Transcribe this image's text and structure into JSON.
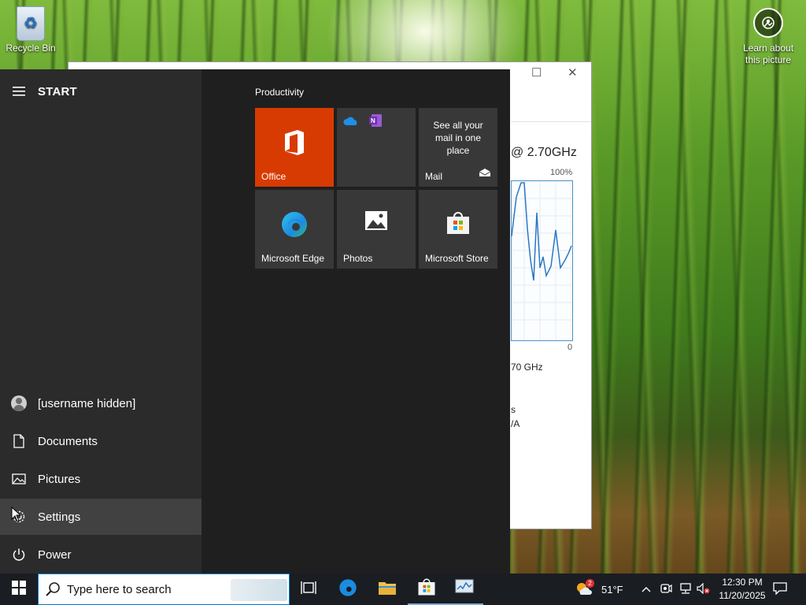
{
  "desktop": {
    "recycle_bin_label": "Recycle Bin",
    "learn_label_line1": "Learn about",
    "learn_label_line2": "this picture"
  },
  "background_window": {
    "cpu_speed": "@ 2.70GHz",
    "graph_max": "100%",
    "graph_min": "0",
    "speed_partial": "70 GHz",
    "partial_1": "s",
    "partial_2": "/A"
  },
  "start_menu": {
    "title": "START",
    "user": {
      "name": "[username hidden]"
    },
    "items": [
      {
        "label": "Documents",
        "icon": "document-icon"
      },
      {
        "label": "Pictures",
        "icon": "pictures-icon"
      },
      {
        "label": "Settings",
        "icon": "gear-icon",
        "hovered": true
      },
      {
        "label": "Power",
        "icon": "power-icon"
      }
    ],
    "group_title": "Productivity",
    "tiles": [
      {
        "label": "Office",
        "color": "#d83b01"
      },
      {
        "label": "",
        "icons": [
          "onedrive-icon",
          "onenote-icon"
        ]
      },
      {
        "label": "Mail",
        "preview": "See all your mail in one place"
      },
      {
        "label": "Microsoft Edge"
      },
      {
        "label": "Photos"
      },
      {
        "label": "Microsoft Store"
      }
    ]
  },
  "taskbar": {
    "search_placeholder": "Type here to search",
    "weather_temp": "51°F",
    "weather_badge": "2",
    "time": "12:30 PM",
    "date": "11/20/2025",
    "apps": [
      "task-view",
      "edge",
      "file-explorer",
      "store",
      "task-manager"
    ]
  },
  "colors": {
    "accent": "#0078d7",
    "office_tile": "#d83b01",
    "start_bg": "#1f1f1f",
    "start_left_bg": "#2b2b2b",
    "tile_bg": "#383838",
    "taskbar_bg": "#1a1d22"
  }
}
